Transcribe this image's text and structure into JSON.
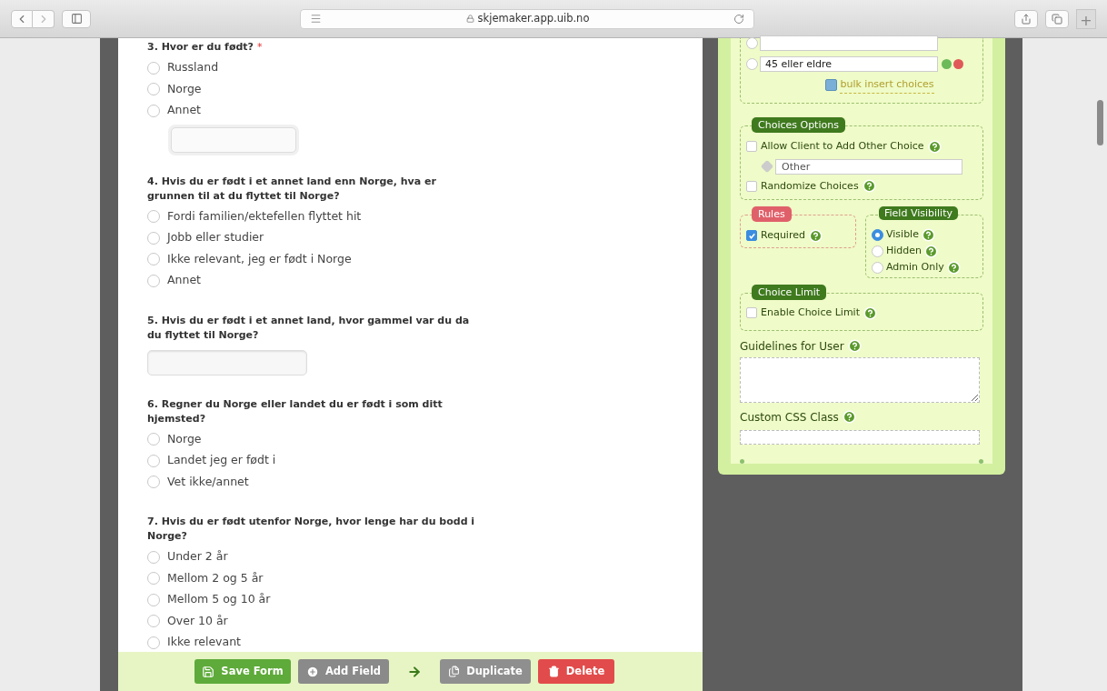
{
  "browser": {
    "url": "skjemaker.app.uib.no",
    "new_tab": "+"
  },
  "form": {
    "questions": [
      {
        "kind": "radio_other",
        "title": "3. Hvor er du født?",
        "required_mark": "*",
        "options": [
          {
            "label": "Russland",
            "selected": false
          },
          {
            "label": "Norge",
            "selected": false
          },
          {
            "label": "Annet",
            "selected": false
          }
        ]
      },
      {
        "kind": "radio",
        "title": "4. Hvis du er født i et annet land enn Norge, hva er grunnen til at du flyttet til Norge?",
        "options": [
          {
            "label": "Fordi familien/ektefellen flyttet hit",
            "selected": false
          },
          {
            "label": "Jobb eller studier",
            "selected": false
          },
          {
            "label": "Ikke relevant, jeg er født i Norge",
            "selected": false
          },
          {
            "label": "Annet",
            "selected": false
          }
        ]
      },
      {
        "kind": "text",
        "title": "5. Hvis du er født i et annet land, hvor gammel var du da du flyttet til Norge?"
      },
      {
        "kind": "radio",
        "title": "6. Regner du Norge eller landet du er født i som ditt hjemsted?",
        "options": [
          {
            "label": "Norge",
            "selected": false
          },
          {
            "label": "Landet jeg er født i",
            "selected": false
          },
          {
            "label": "Vet ikke/annet",
            "selected": false
          }
        ]
      },
      {
        "kind": "radio",
        "title": "7. Hvis du er født utenfor Norge, hvor lenge har du bodd i Norge?",
        "options": [
          {
            "label": "Under 2 år",
            "selected": false
          },
          {
            "label": "Mellom 2 og 5 år",
            "selected": false
          },
          {
            "label": "Mellom 5 og 10 år",
            "selected": false
          },
          {
            "label": "Over 10 år",
            "selected": false
          },
          {
            "label": "Ikke relevant",
            "selected": false
          }
        ]
      }
    ]
  },
  "toolbar": [
    {
      "kind": "save",
      "label": "Save Form"
    },
    {
      "kind": "add",
      "label": "Add Field"
    },
    {
      "kind": "duplicate",
      "label": "Duplicate"
    },
    {
      "kind": "delete",
      "label": "Delete"
    }
  ],
  "panel": {
    "choices": [
      {
        "selected": false
      },
      {
        "value": "45 eller eldre",
        "selected": false
      }
    ],
    "bulk_link": "bulk insert choices",
    "choices_options": {
      "legend": "Choices Options",
      "allow_other": {
        "label": "Allow Client to Add Other Choice",
        "checked": false
      },
      "other_value": "Other",
      "randomize": {
        "label": "Randomize Choices",
        "checked": false
      }
    },
    "rules": {
      "legend": "Rules",
      "required": {
        "label": "Required",
        "checked": true
      }
    },
    "visibility": {
      "legend": "Field Visibility",
      "options": [
        {
          "label": "Visible",
          "selected": true
        },
        {
          "label": "Hidden",
          "selected": false
        },
        {
          "label": "Admin Only",
          "selected": false
        }
      ]
    },
    "choice_limit": {
      "legend": "Choice Limit",
      "enable": {
        "label": "Enable Choice Limit",
        "checked": false
      }
    },
    "guidelines": {
      "label": "Guidelines for User"
    },
    "css_class": {
      "label": "Custom CSS Class"
    }
  }
}
